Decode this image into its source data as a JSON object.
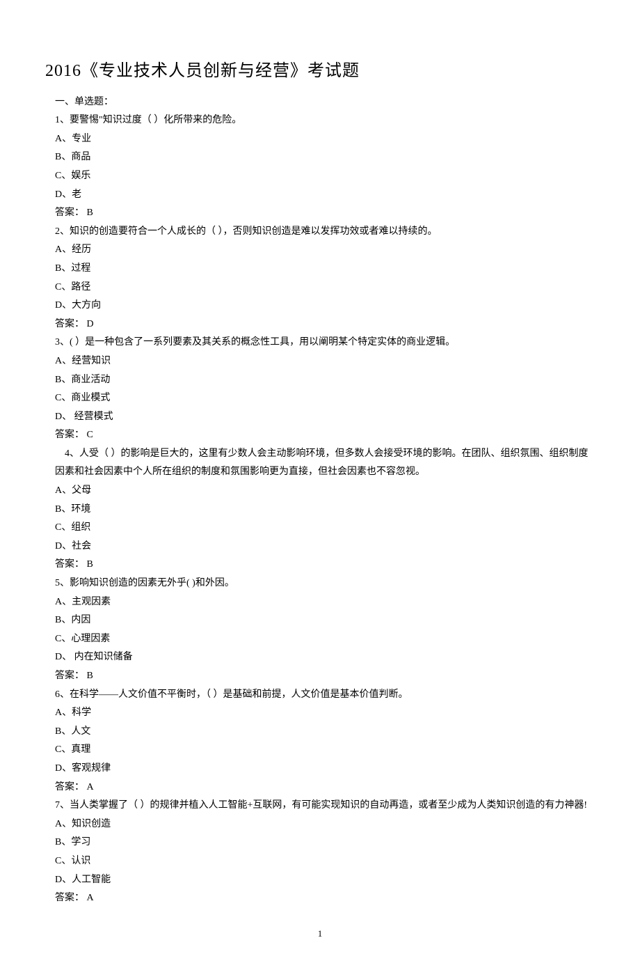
{
  "title": "2016《专业技术人员创新与经营》考试题",
  "sectionHeader": "一、单选题：",
  "questions": [
    {
      "stem": "1、要警惕\"知识过度（ ）化所带来的危险。",
      "opts": [
        "A、专业",
        "B、商品",
        "C、娱乐",
        "D、老"
      ],
      "answer": "答案： B"
    },
    {
      "stem": "2、知识的创造要符合一个人成长的（ ），否则知识创造是难以发挥功效或者难以持续的。",
      "opts": [
        "A、经历",
        "B、过程",
        "C、路径",
        "D、大方向"
      ],
      "answer": "答案： D"
    },
    {
      "stem": "3、( ）是一种包含了一系列要素及其关系的概念性工具，用以阐明某个特定实体的商业逻辑。",
      "opts": [
        "A、经营知识",
        "B、商业活动",
        "C、商业模式",
        "D、 经营模式"
      ],
      "answer": "答案： C"
    },
    {
      "stem": "4、人受（ ）的影响是巨大的，这里有少数人会主动影响环境，但多数人会接受环境的影响。在团队、组织氛围、组织制度因素和社会因素中个人所在组织的制度和氛围影响更为直接，但社会因素也不容忽视。",
      "opts": [
        "A、父母",
        "B、环境",
        "C、组织",
        "D、社会"
      ],
      "answer": "答案： B"
    },
    {
      "stem": " 5、影响知识创造的因素无外乎( )和外因。",
      "opts": [
        "A、主观因素",
        "B、内因",
        "C、心理因素",
        "D、 内在知识储备"
      ],
      "answer": "答案： B"
    },
    {
      "stem": "6、在科学——人文价值不平衡时，（ ）是基础和前提，人文价值是基本价值判断。",
      "opts": [
        "A、科学",
        "B、人文",
        "C、真理",
        "D、客观规律"
      ],
      "answer": "答案： A"
    },
    {
      "stem": " 7、当人类掌握了（ ）的规律并植入人工智能+互联网，有可能实现知识的自动再造，或者至少成为人类知识创造的有力神器!",
      "opts": [
        "A、知识创造",
        "B、学习",
        "C、认识",
        "D、人工智能"
      ],
      "answer": "答案： A"
    }
  ],
  "pageNumber": "1"
}
